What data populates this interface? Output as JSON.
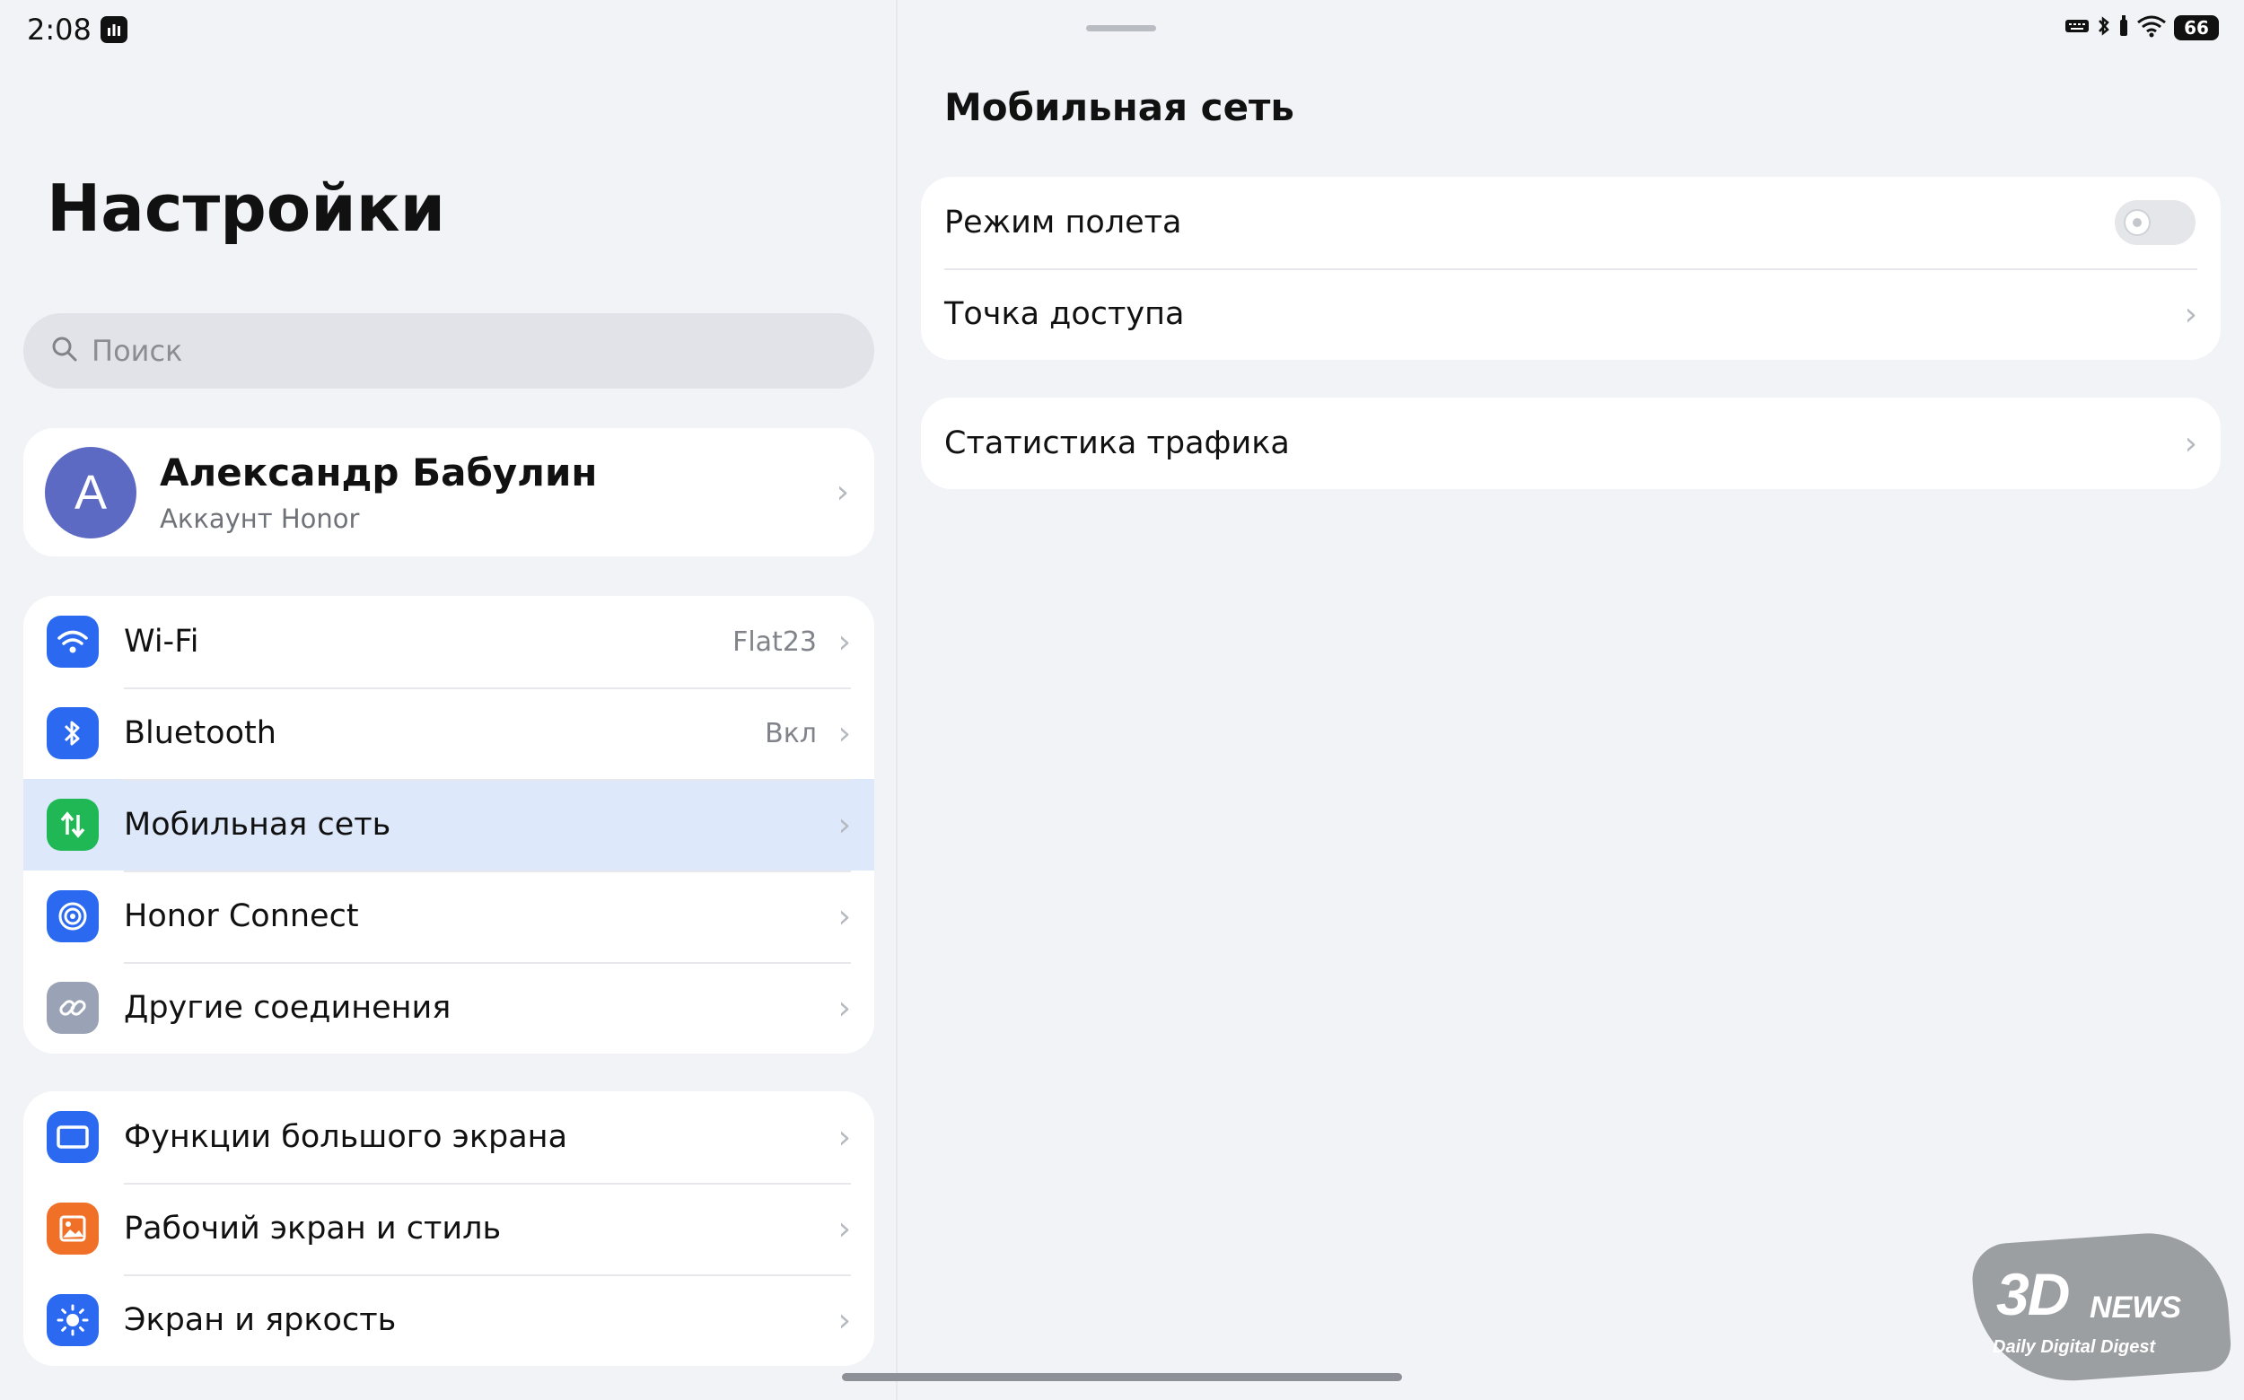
{
  "status_bar": {
    "time": "2:08",
    "battery": "66"
  },
  "sidebar": {
    "title": "Настройки",
    "search": {
      "placeholder": "Поиск"
    },
    "account": {
      "initial": "А",
      "name": "Александр Бабулин",
      "subtitle": "Аккаунт Honor"
    },
    "groups": [
      {
        "items": [
          {
            "label": "Wi-Fi",
            "value": "Flat23",
            "icon": "wifi-icon",
            "color": "#2b6af0"
          },
          {
            "label": "Bluetooth",
            "value": "Вкл",
            "icon": "bluetooth-icon",
            "color": "#2b6af0"
          },
          {
            "label": "Мобильная сеть",
            "value": "",
            "icon": "mobile-data-icon",
            "color": "#1fb855",
            "selected": true
          },
          {
            "label": "Honor Connect",
            "value": "",
            "icon": "honor-connect-icon",
            "color": "#2b6af0"
          },
          {
            "label": "Другие соединения",
            "value": "",
            "icon": "link-icon",
            "color": "#9aa3b5"
          }
        ]
      },
      {
        "items": [
          {
            "label": "Функции большого экрана",
            "value": "",
            "icon": "large-screen-icon",
            "color": "#2b6af0"
          },
          {
            "label": "Рабочий экран и стиль",
            "value": "",
            "icon": "wallpaper-icon",
            "color": "#f07028"
          },
          {
            "label": "Экран и яркость",
            "value": "",
            "icon": "brightness-icon",
            "color": "#2b6af0"
          }
        ]
      }
    ]
  },
  "detail": {
    "title": "Мобильная сеть",
    "groups": [
      {
        "items": [
          {
            "label": "Режим полета",
            "control": "toggle",
            "on": false
          },
          {
            "label": "Точка доступа",
            "control": "chevron"
          }
        ]
      },
      {
        "items": [
          {
            "label": "Статистика трафика",
            "control": "chevron"
          }
        ]
      }
    ]
  },
  "watermark": {
    "brand": "3D",
    "brand_suffix": "NEWS",
    "tagline": "Daily Digital Digest"
  }
}
